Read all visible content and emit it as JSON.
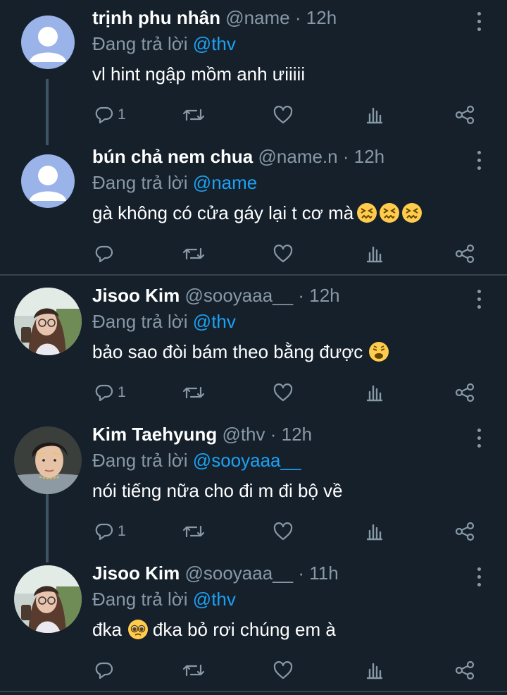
{
  "colors": {
    "background": "#15202b",
    "text": "#ffffff",
    "muted": "#8899a6",
    "link": "#1da1f2",
    "divider": "#38444d"
  },
  "tweets": [
    {
      "display_name": "trịnh phu nhân",
      "handle": "@name",
      "dot": "·",
      "time": "12h",
      "reply_prefix": "Đang trả lời",
      "reply_to": "@thv",
      "text": "vl hint ngập mồm anh ưiiiii",
      "emojis": [],
      "reply_count": "1",
      "avatar": "default-avatar"
    },
    {
      "display_name": "bún chả nem chua",
      "handle": "@name.n",
      "dot": "·",
      "time": "12h",
      "reply_prefix": "Đang trả lời",
      "reply_to": "@name",
      "text": "gà không có cửa gáy lại t cơ mà",
      "emojis": [
        "confounded-face",
        "confounded-face",
        "confounded-face"
      ],
      "reply_count": "",
      "avatar": "default-avatar"
    },
    {
      "display_name": "Jisoo Kim",
      "handle": "@sooyaaa__",
      "dot": "·",
      "time": "12h",
      "reply_prefix": "Đang trả lời",
      "reply_to": "@thv",
      "text": "bảo sao đòi bám theo bằng được",
      "emojis": [
        "weary-face"
      ],
      "reply_count": "1",
      "avatar": "photo-avatar"
    },
    {
      "display_name": "Kim Taehyung",
      "handle": "@thv",
      "dot": "·",
      "time": "12h",
      "reply_prefix": "Đang trả lời",
      "reply_to": "@sooyaaa__",
      "text": "nói tiếng nữa cho đi m đi bộ về",
      "emojis": [],
      "reply_count": "1",
      "avatar": "photo-avatar"
    },
    {
      "display_name": "Jisoo Kim",
      "handle": "@sooyaaa__",
      "dot": "·",
      "time": "11h",
      "reply_prefix": "Đang trả lời",
      "reply_to": "@thv",
      "text": "đka",
      "text_after": "đka bỏ rơi chúng em à",
      "emojis": [
        "pleading-face"
      ],
      "reply_count": "",
      "avatar": "photo-avatar"
    }
  ],
  "icons": {
    "reply": "reply-icon",
    "retweet": "retweet-icon",
    "like": "heart-icon",
    "analytics": "analytics-icon",
    "share": "share-icon",
    "more": "more-options-icon"
  }
}
